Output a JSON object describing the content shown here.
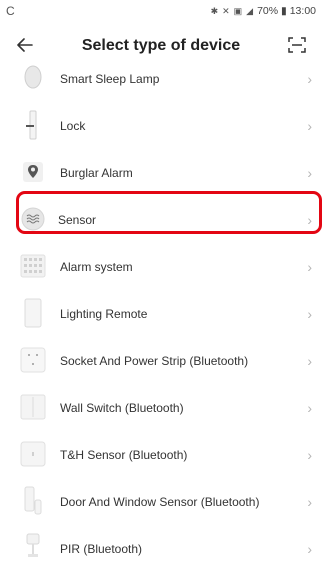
{
  "status_bar": {
    "left_icon": "c-icon",
    "right_text": "70% ▮ 13:00"
  },
  "header": {
    "title": "Select type of device",
    "back_icon": "arrow-left-icon",
    "scan_icon": "scan-icon"
  },
  "devices": [
    {
      "label": "Smart Sleep Lamp",
      "icon": "lamp-icon"
    },
    {
      "label": "Lock",
      "icon": "lock-icon"
    },
    {
      "label": "Burglar Alarm",
      "icon": "location-pin-icon"
    },
    {
      "label": "Sensor",
      "icon": "wave-sensor-icon",
      "highlighted": true
    },
    {
      "label": "Alarm system",
      "icon": "keypad-icon"
    },
    {
      "label": "Lighting Remote",
      "icon": "remote-icon"
    },
    {
      "label": "Socket And Power Strip (Bluetooth)",
      "icon": "socket-icon"
    },
    {
      "label": "Wall Switch (Bluetooth)",
      "icon": "wall-switch-icon"
    },
    {
      "label": "T&H Sensor (Bluetooth)",
      "icon": "th-sensor-icon"
    },
    {
      "label": "Door And Window Sensor (Bluetooth)",
      "icon": "door-sensor-icon"
    },
    {
      "label": "PIR (Bluetooth)",
      "icon": "pir-icon"
    }
  ],
  "highlight_color": "#e30613"
}
